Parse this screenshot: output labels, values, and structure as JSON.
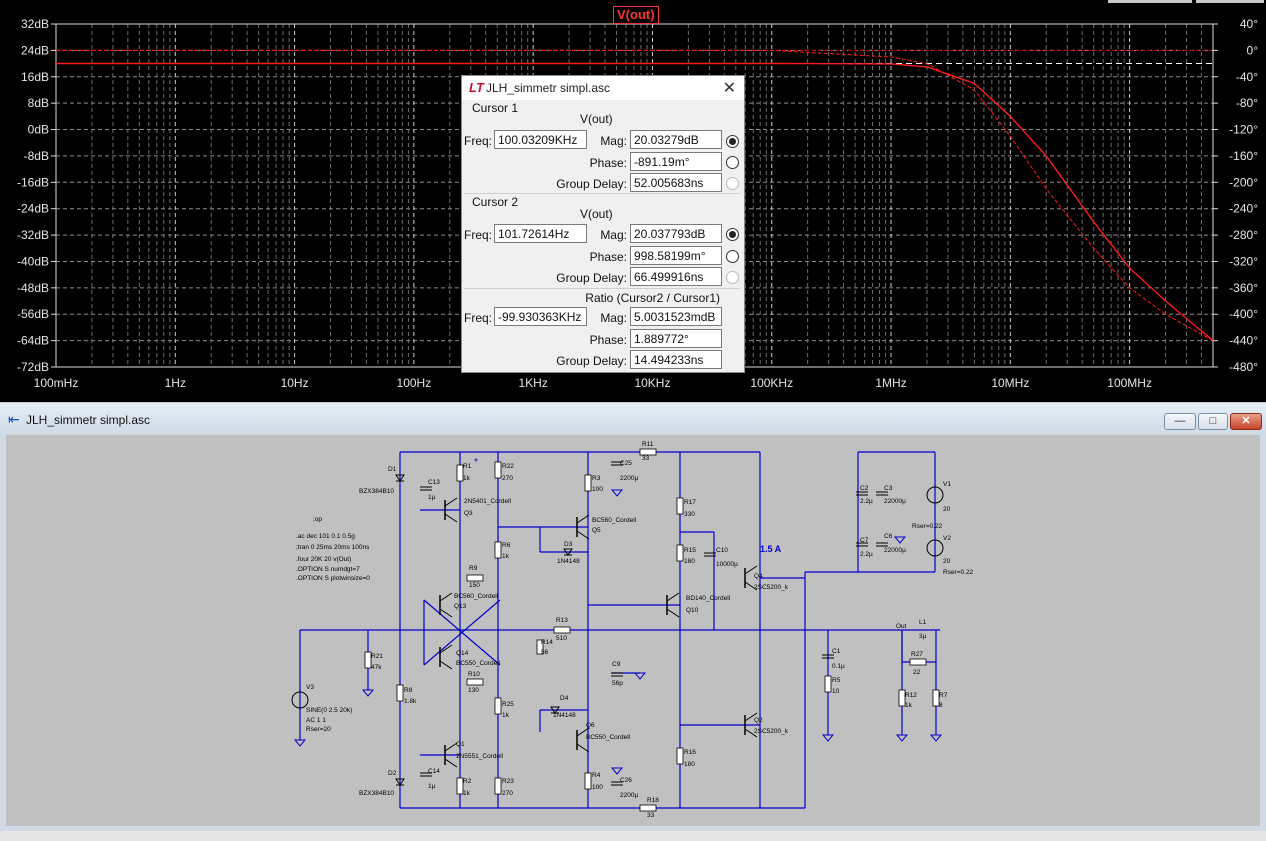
{
  "plot": {
    "title": "V(out)",
    "mag_ticks": [
      "32dB",
      "24dB",
      "16dB",
      "8dB",
      "0dB",
      "-8dB",
      "-16dB",
      "-24dB",
      "-32dB",
      "-40dB",
      "-48dB",
      "-56dB",
      "-64dB",
      "-72dB"
    ],
    "phase_ticks": [
      "40°",
      "0°",
      "-40°",
      "-80°",
      "-120°",
      "-160°",
      "-200°",
      "-240°",
      "-280°",
      "-320°",
      "-360°",
      "-400°",
      "-440°",
      "-480°"
    ],
    "freq_ticks": [
      "100mHz",
      "1Hz",
      "10Hz",
      "100Hz",
      "1KHz",
      "10KHz",
      "100KHz",
      "1MHz",
      "10MHz",
      "100MHz"
    ],
    "colors": {
      "trace": "#ff1a1a",
      "grid": "#8c8c8c",
      "phase_dash": "#a0a0a0",
      "cursor_line": "#ffffff"
    }
  },
  "chart_data": {
    "type": "line",
    "title": "V(out)",
    "x_scale": "log",
    "x_range_hz": [
      0.1,
      500000000
    ],
    "y_left_range_db": [
      -72,
      32
    ],
    "y_right_range_deg": [
      -480,
      40
    ],
    "grid": true,
    "series": [
      {
        "name": "V(out)",
        "axis": "magnitude",
        "x_hz": [
          0.1,
          100000,
          1000000,
          2000000,
          5000000,
          10000000,
          20000000,
          50000000,
          100000000,
          200000000,
          500000000
        ],
        "y_db": [
          20.03,
          20.03,
          19.9,
          19.0,
          14.0,
          4.0,
          -8.0,
          -28.0,
          -42.0,
          -52.0,
          -64.0
        ]
      },
      {
        "name": "V(out)",
        "axis": "phase",
        "x_hz": [
          0.1,
          100000,
          1000000,
          2000000,
          5000000,
          10000000,
          20000000,
          50000000,
          100000000,
          200000000,
          500000000
        ],
        "y_deg": [
          0,
          0,
          -10,
          -20,
          -60,
          -130,
          -210,
          -300,
          -360,
          -400,
          -440
        ]
      }
    ]
  },
  "dialog": {
    "title": "JLH_simmetr simpl.asc",
    "cursor1": {
      "label": "Cursor 1",
      "trace": "V(out)",
      "freq_label": "Freq:",
      "freq": "100.03209KHz",
      "mag_label": "Mag:",
      "mag": "20.03279dB",
      "phase_label": "Phase:",
      "phase": "-891.19m°",
      "gd_label": "Group Delay:",
      "gd": "52.005683ns"
    },
    "cursor2": {
      "label": "Cursor 2",
      "trace": "V(out)",
      "freq_label": "Freq:",
      "freq": "101.72614Hz",
      "mag_label": "Mag:",
      "mag": "20.037793dB",
      "phase_label": "Phase:",
      "phase": "998.58199m°",
      "gd_label": "Group Delay:",
      "gd": "66.499916ns"
    },
    "ratio": {
      "label": "Ratio (Cursor2 / Cursor1)",
      "freq_label": "Freq:",
      "freq": "-99.930363KHz",
      "mag_label": "Mag:",
      "mag": "5.0031523mdB",
      "phase_label": "Phase:",
      "phase": "1.889772°",
      "gd_label": "Group Delay:",
      "gd": "14.494233ns"
    }
  },
  "schematic": {
    "title": "JLH_simmetr simpl.asc",
    "wire_color": "#0000cc",
    "directives": [
      ";op",
      ".ac dec 101 0.1 0.5g",
      ";tran 0 25ms 20ms 100ns",
      ".four 20K 20 v(Out)",
      ".OPTION S numdgt=7",
      ".OPTION S plotwinsize=0"
    ],
    "current_label": "1.5 A",
    "out_label": "Out",
    "components": {
      "D1": "D1",
      "D1v": "BZX384B10",
      "D2": "D2",
      "D2v": "BZX384B10",
      "C13": "C13",
      "C13v": "1µ",
      "C14": "C14",
      "C14v": "1µ",
      "R1": "R1",
      "R1v": "1k",
      "R2": "R2",
      "R2v": "1k",
      "star": "*",
      "R22": "R22",
      "R22v": "270",
      "R23": "R23",
      "R23v": "270",
      "Q3m": "2N5401_Cordell",
      "Q3": "Q3",
      "Q1": "Q1",
      "Q1m": "2N5551_Cordell",
      "R6": "R6",
      "R6v": "1k",
      "R9": "R9",
      "R9v": "150",
      "R10": "R10",
      "R10v": "130",
      "Q13m": "BC560_Cordell",
      "Q13": "Q13",
      "Q14": "Q14",
      "Q14m": "BC550_Cordell",
      "R8": "R8",
      "R8v": "1.8k",
      "R21": "R21",
      "R21v": "47k",
      "V3": "V3",
      "V3v1": "SINE(0 2.5 20k)",
      "V3v2": "AC 1 1",
      "V3v3": "Rser=20",
      "R11": "R11",
      "R11v": "33",
      "R18": "R18",
      "R18v": "33",
      "R3": "R3",
      "R3v": "100",
      "R4": "R4",
      "R4v": "100",
      "C25": "C25",
      "C25v": "2200µ",
      "C26": "C26",
      "C26v": "2200µ",
      "Q5m": "BC560_Cordell",
      "Q5": "Q5",
      "D3": "D3",
      "D3v": "1N4148",
      "D4": "D4",
      "D4v": "1N4148",
      "Q6": "Q6",
      "Q6m": "BC550_Cordell",
      "R13": "R13",
      "R13v": "510",
      "R14": "R14",
      "R14v": "56",
      "R25": "R25",
      "R25v": "1k",
      "C9": "C9",
      "C9v": "56p",
      "R17": "R17",
      "R17v": "330",
      "R15": "R15",
      "R15v": "180",
      "R16": "R16",
      "R16v": "180",
      "C10": "C10",
      "C10v": "10000µ",
      "Q10m": "BD140_Cordell",
      "Q10": "Q10",
      "Q4": "Q4",
      "Q4m": "2SC5200_k",
      "Q2": "Q2",
      "Q2m": "2SC5200_k",
      "C2": "C2",
      "C2v": "2.2µ",
      "C3": "C3",
      "C3v": "22000µ",
      "C7": "C7",
      "C7v": "2.2µ",
      "C6": "C6",
      "C6v": "22000µ",
      "V1": "V1",
      "V1v": "20",
      "V1r": "Rser=0.22",
      "V2": "V2",
      "V2v": "20",
      "V2r": "Rser=0.22",
      "C1": "C1",
      "C1v": "0.1µ",
      "R5": "R5",
      "R5v": "10",
      "L1": "L1",
      "L1v": "3µ",
      "R27": "R27",
      "R27v": "22",
      "R12": "R12",
      "R12v": "1k",
      "R7": "R7",
      "R7v": "8"
    }
  }
}
